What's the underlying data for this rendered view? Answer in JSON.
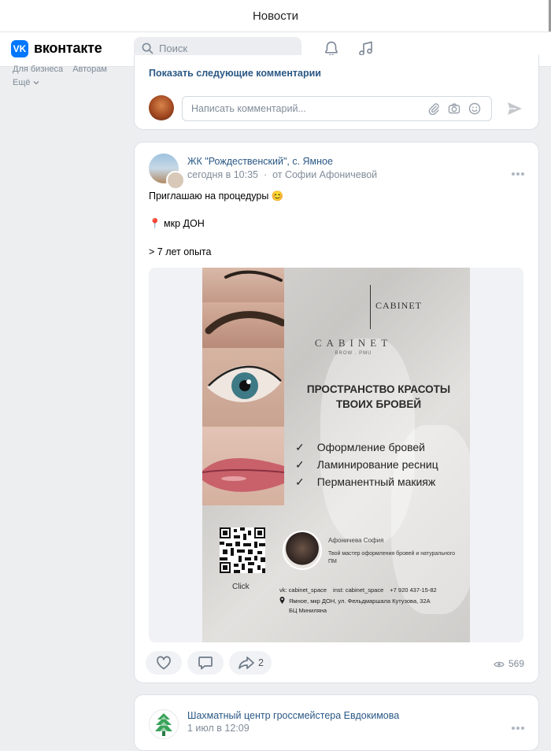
{
  "window": {
    "title": "Новости"
  },
  "header": {
    "logo_text": "вконтакте",
    "logo_glyph": "VK",
    "search_placeholder": "Поиск"
  },
  "left_menu": {
    "items": [
      "Для бизнеса",
      "Авторам"
    ],
    "more": "Ещё"
  },
  "comments_card": {
    "show_more": "Показать следующие комментарии",
    "comment_placeholder": "Написать комментарий..."
  },
  "post": {
    "author": "ЖК \"Рождественский\", с. Ямное",
    "date": "сегодня в 10:35",
    "separator": "·",
    "from": "от Софии Афоничевой",
    "lines": [
      "Приглашаю на процедуры 😊",
      "📍 мкр ДОН",
      "> 7 лет опыта"
    ],
    "poster": {
      "brand_small": "CABINET",
      "brand_large": "CABINET",
      "brand_sub": "BROW . PMU",
      "headline_1": "ПРОСТРАНСТВО КРАСОТЫ",
      "headline_2": "ТВОИХ БРОВЕЙ",
      "check": "✓",
      "services": [
        "Оформление бровей",
        "Ламинирование ресниц",
        "Перманентный макияж"
      ],
      "qr_caption": "Click",
      "master_name": "Афоничева София",
      "master_desc": "Твой мастер оформления бровей и натурального ПМ",
      "vk": "vk: cabinet_space",
      "inst": "inst: cabinet_space",
      "phone": "+7 920 437-15-82",
      "address_1": "Ямное, мкр ДОН, ул. Фельдмаршала Кутузова, 32А",
      "address_2": "БЦ Миниляна"
    },
    "shares": "2",
    "views": "569"
  },
  "next_post": {
    "author": "Шахматный центр гроссмейстера Евдокимова",
    "date": "1 июл в 12:09"
  },
  "colors": {
    "accent": "#0077ff",
    "link": "#2a5885",
    "muted": "#818c99",
    "bg": "#edeef0"
  }
}
